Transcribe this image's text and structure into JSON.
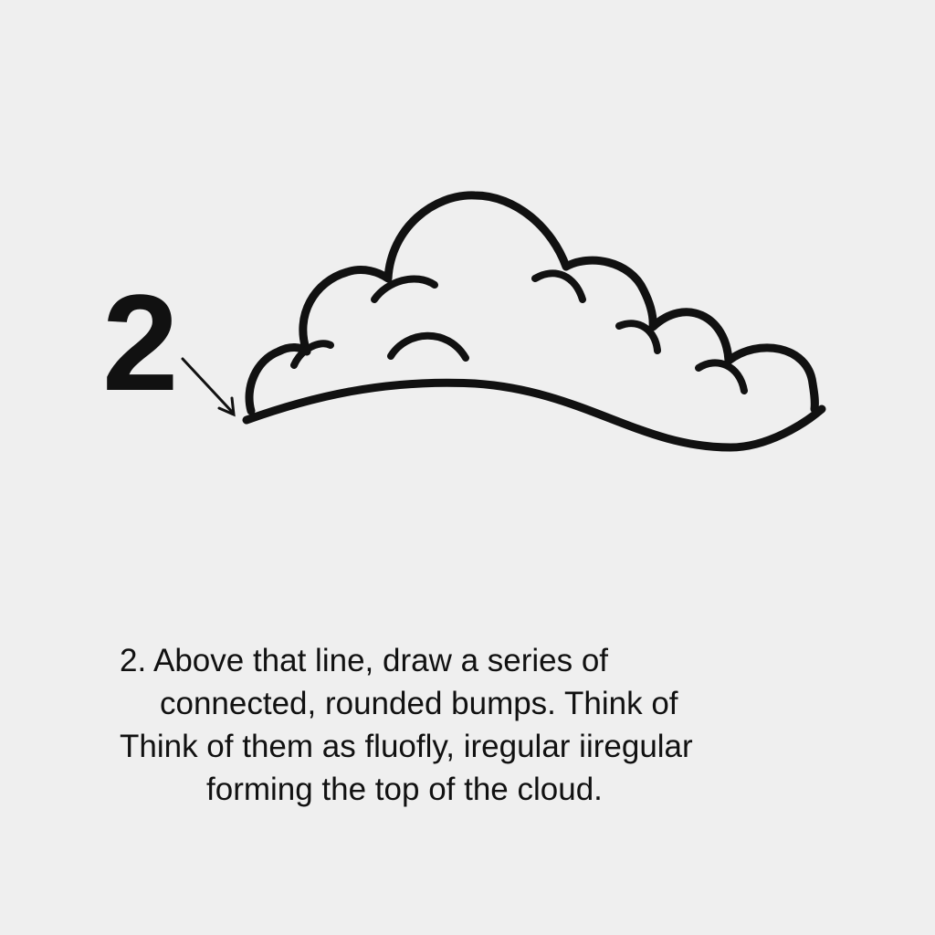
{
  "step": {
    "number": "2"
  },
  "instruction": {
    "lines": [
      "2. Above that line, draw a series of",
      "connected, rounded bumps. Think of",
      "Think of them as fluofly, iregular iiregular",
      "forming the top of the cloud."
    ]
  },
  "colors": {
    "background": "#efefef",
    "ink": "#111111"
  },
  "icons": {
    "arrow": "pointer-arrow-icon",
    "cloud": "cloud-drawing-icon"
  }
}
